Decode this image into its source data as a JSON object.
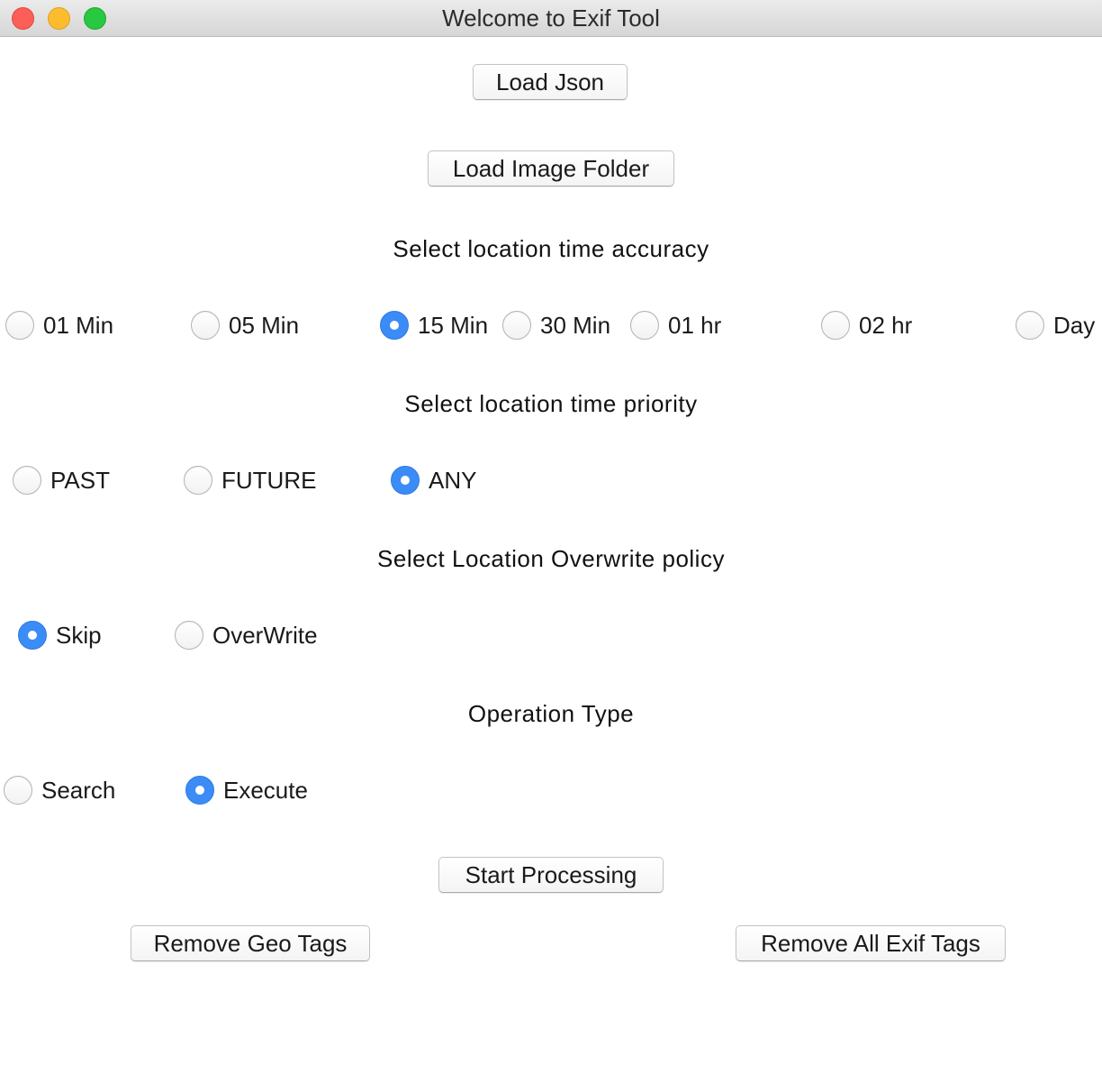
{
  "window": {
    "title": "Welcome to Exif Tool"
  },
  "buttons": {
    "load_json": "Load Json",
    "load_image_folder": "Load Image Folder",
    "start_processing": "Start Processing",
    "remove_geo_tags": "Remove Geo Tags",
    "remove_all_exif_tags": "Remove All Exif Tags"
  },
  "accuracy": {
    "heading": "Select location time accuracy",
    "selected": "15 Min",
    "options": [
      "01 Min",
      "05 Min",
      "15 Min",
      "30 Min",
      "01 hr",
      "02 hr",
      "Day"
    ]
  },
  "priority": {
    "heading": "Select location time priority",
    "selected": "ANY",
    "options": [
      "PAST",
      "FUTURE",
      "ANY"
    ]
  },
  "overwrite": {
    "heading": "Select Location Overwrite policy",
    "selected": "Skip",
    "options": [
      "Skip",
      "OverWrite"
    ]
  },
  "operation": {
    "heading": "Operation Type",
    "selected": "Execute",
    "options": [
      "Search",
      "Execute"
    ]
  },
  "colors": {
    "accent": "#3b8cf6",
    "close": "#fc5f57",
    "minimize": "#fdbc2e",
    "maximize": "#28c840"
  }
}
